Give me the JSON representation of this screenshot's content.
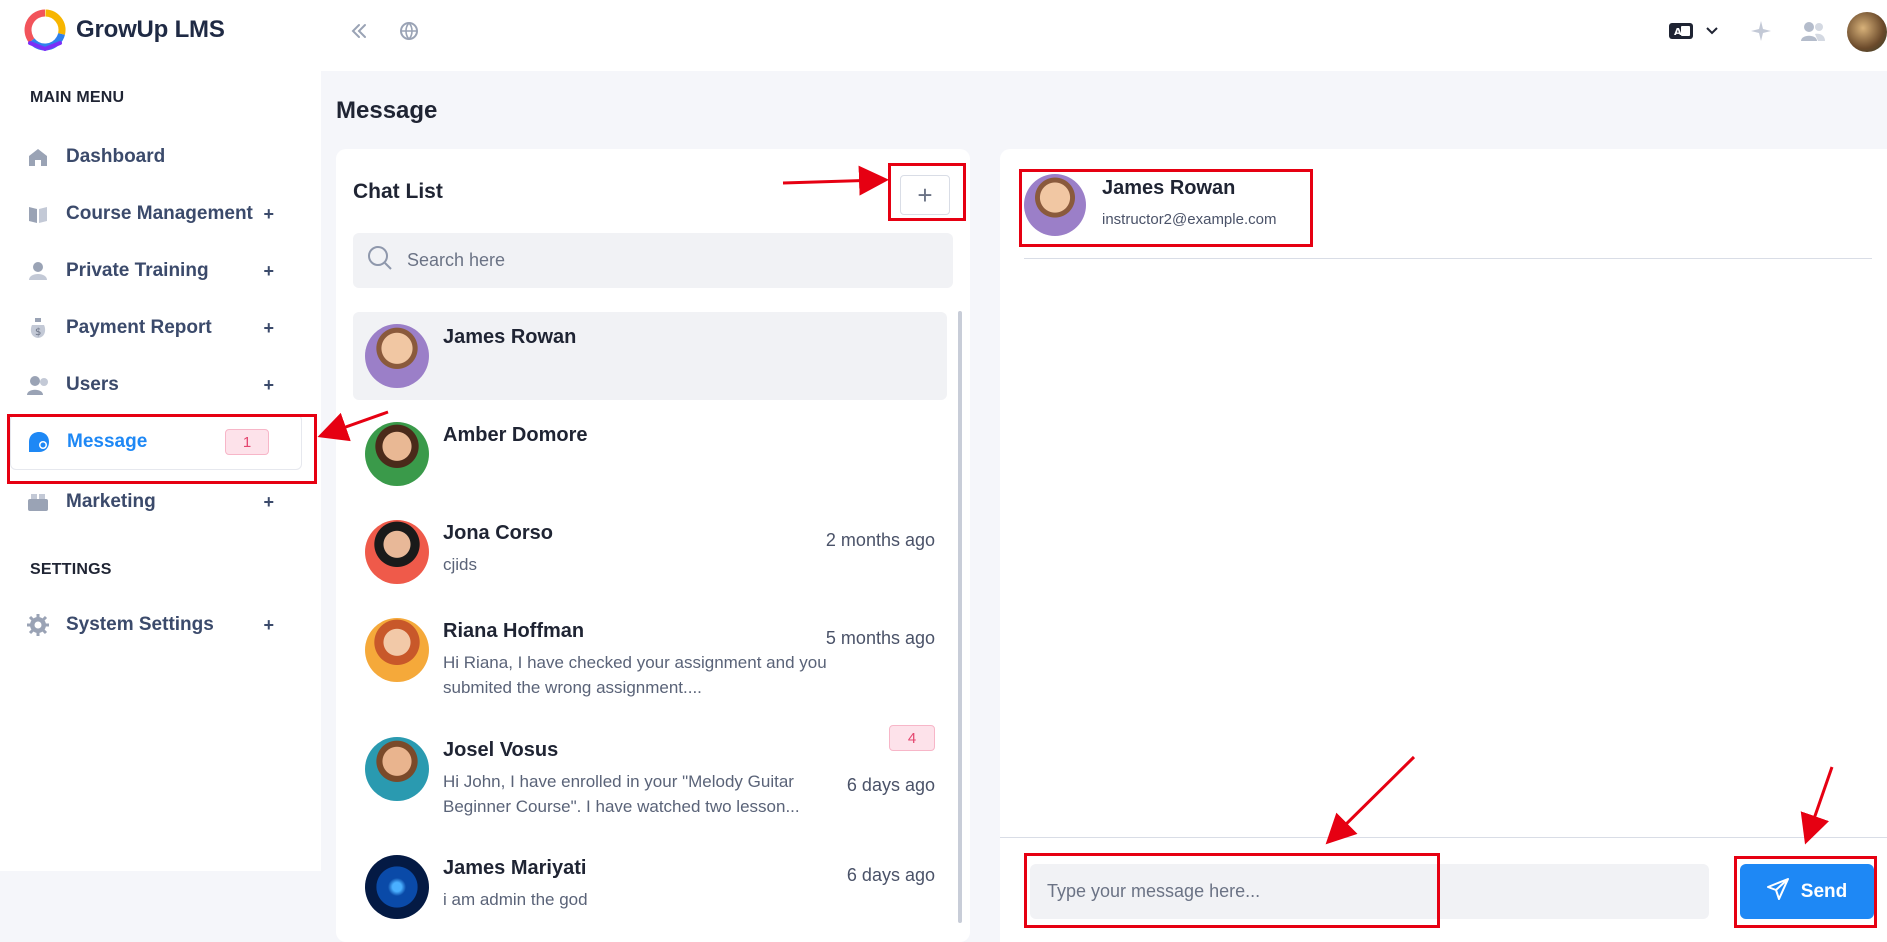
{
  "app": {
    "name": "GrowUp LMS"
  },
  "topbar": {
    "icons": [
      "collapse-icon",
      "globe-icon",
      "language-icon",
      "chevron-down-icon",
      "sparkle-icon",
      "users-icon"
    ]
  },
  "sidebar": {
    "main_heading": "MAIN MENU",
    "items": [
      {
        "label": "Dashboard",
        "icon": "home-icon",
        "expandable": false
      },
      {
        "label": "Course Management",
        "icon": "book-icon",
        "expandable": true
      },
      {
        "label": "Private Training",
        "icon": "person-icon",
        "expandable": true
      },
      {
        "label": "Payment Report",
        "icon": "money-bag-icon",
        "expandable": true
      },
      {
        "label": "Users",
        "icon": "users-icon",
        "expandable": true
      },
      {
        "label": "Message",
        "icon": "chat-icon",
        "badge": "1",
        "active": true
      },
      {
        "label": "Marketing",
        "icon": "megaphone-icon",
        "expandable": true
      }
    ],
    "settings_heading": "SETTINGS",
    "settings_items": [
      {
        "label": "System Settings",
        "icon": "gear-icon",
        "expandable": true
      }
    ],
    "expand_symbol": "+"
  },
  "page": {
    "title": "Message"
  },
  "chat_list": {
    "title": "Chat List",
    "new_chat_symbol": "+",
    "search_placeholder": "Search here",
    "chats": [
      {
        "name": "James Rowan",
        "preview": "",
        "time": "",
        "selected": true
      },
      {
        "name": "Amber Domore",
        "preview": "",
        "time": ""
      },
      {
        "name": "Jona Corso",
        "preview": "cjids",
        "time": "2 months ago"
      },
      {
        "name": "Riana Hoffman",
        "preview": "Hi Riana, I have checked your assignment and you submited the wrong assignment....",
        "time": "5 months ago"
      },
      {
        "name": "Josel Vosus",
        "preview": "Hi John, I have enrolled in your \"Melody Guitar Beginner Course\". I have watched two lesson...",
        "time": "6 days ago",
        "unread": "4"
      },
      {
        "name": "James Mariyati",
        "preview": "i am admin the god",
        "time": "6 days ago"
      }
    ]
  },
  "conversation": {
    "name": "James Rowan",
    "email": "instructor2@example.com",
    "input_placeholder": "Type your message here...",
    "send_label": "Send"
  },
  "colors": {
    "accent": "#1e88f5",
    "badge_bg": "#fde2ea",
    "badge_text": "#e4466f",
    "annotation": "#e60012"
  }
}
